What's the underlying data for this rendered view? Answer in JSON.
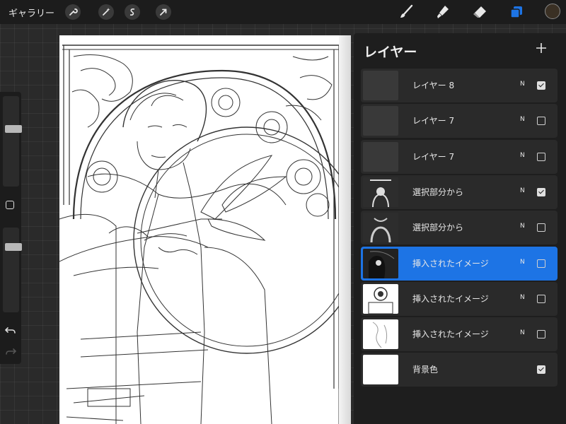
{
  "toolbar": {
    "gallery_label": "ギャラリー",
    "left_icons": [
      "wrench-icon",
      "magic-wand-icon",
      "selection-icon",
      "transform-arrow-icon"
    ],
    "right_icons": [
      "brush-icon",
      "smudge-icon",
      "eraser-icon",
      "layers-icon"
    ],
    "active_tool": "layers",
    "accent_color": "#1d74e5",
    "current_color": "#3a3024"
  },
  "sidebar": {
    "brush_size_level": 0.65,
    "opacity_level": 0.8,
    "icons": [
      "modify-square-icon",
      "undo-icon",
      "redo-icon"
    ]
  },
  "layers_panel": {
    "title": "レイヤー",
    "add_icon": "plus-icon",
    "layers": [
      {
        "name": "レイヤー 8",
        "blend": "N",
        "visible": true,
        "selected": false,
        "thumb": "empty"
      },
      {
        "name": "レイヤー 7",
        "blend": "N",
        "visible": false,
        "selected": false,
        "thumb": "empty"
      },
      {
        "name": "レイヤー 7",
        "blend": "N",
        "visible": false,
        "selected": false,
        "thumb": "empty"
      },
      {
        "name": "選択部分から",
        "blend": "N",
        "visible": true,
        "selected": false,
        "thumb": "arch-frame"
      },
      {
        "name": "選択部分から",
        "blend": "N",
        "visible": false,
        "selected": false,
        "thumb": "moon-frame"
      },
      {
        "name": "挿入されたイメージ",
        "blend": "N",
        "visible": false,
        "selected": true,
        "thumb": "figure"
      },
      {
        "name": "挿入されたイメージ",
        "blend": "N",
        "visible": false,
        "selected": false,
        "thumb": "ornament"
      },
      {
        "name": "挿入されたイメージ",
        "blend": "N",
        "visible": false,
        "selected": false,
        "thumb": "lineart"
      },
      {
        "name": "背景色",
        "blend": "",
        "visible": true,
        "selected": false,
        "thumb": "white"
      }
    ]
  }
}
